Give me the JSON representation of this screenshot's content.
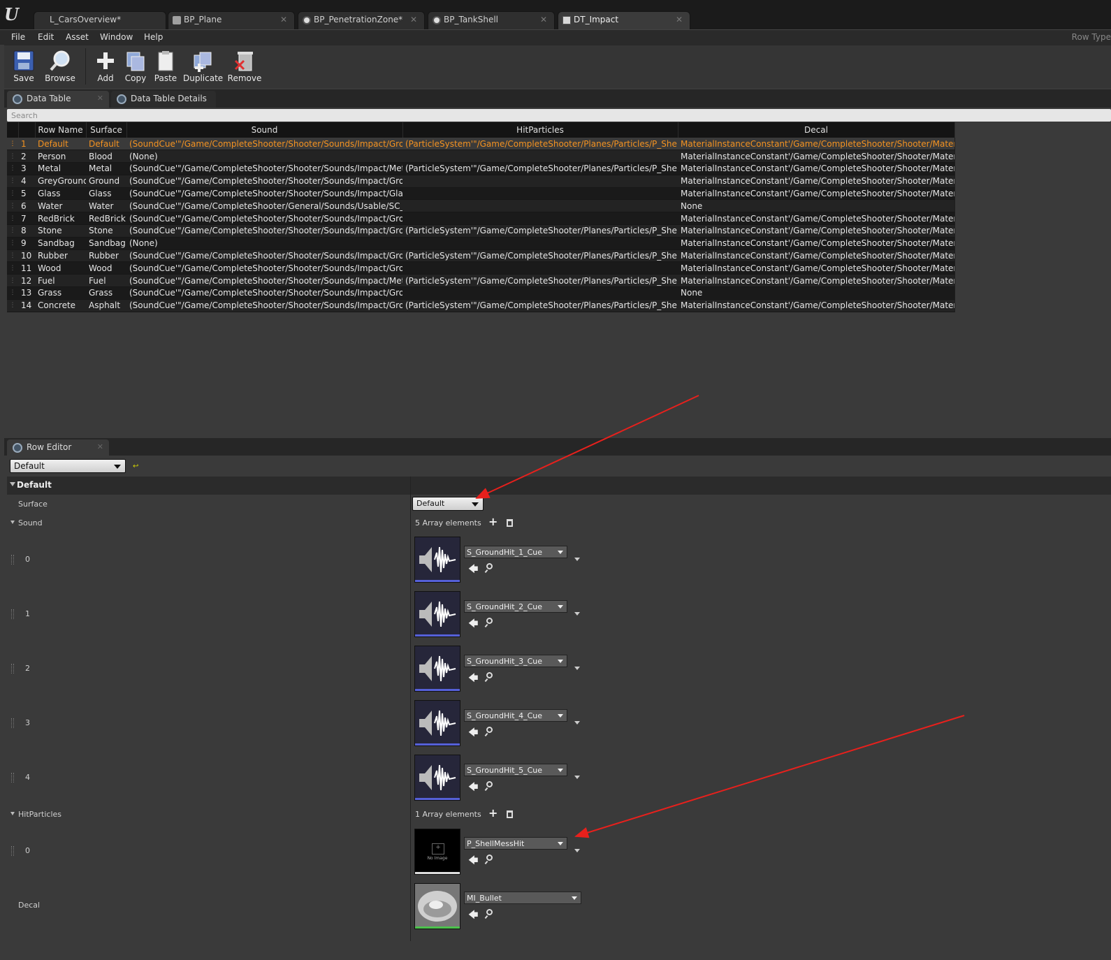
{
  "title_tabs": [
    {
      "label": "L_CarsOverview*",
      "icon": "level-icon"
    },
    {
      "label": "BP_Plane",
      "icon": "blueprint-icon"
    },
    {
      "label": "BP_PenetrationZone*",
      "icon": "blueprint-icon"
    },
    {
      "label": "BP_TankShell",
      "icon": "blueprint-icon"
    },
    {
      "label": "DT_Impact",
      "icon": "datatable-icon"
    }
  ],
  "menu": [
    "File",
    "Edit",
    "Asset",
    "Window",
    "Help"
  ],
  "menu_right": "Row Type",
  "toolbar": [
    "Save",
    "Browse",
    "Add",
    "Copy",
    "Paste",
    "Duplicate",
    "Remove"
  ],
  "panel_tabs": [
    "Data Table",
    "Data Table Details"
  ],
  "search_placeholder": "Search",
  "table": {
    "headers": [
      "Row Name",
      "Surface",
      "Sound",
      "HitParticles",
      "Decal"
    ],
    "rows": [
      [
        "1",
        "Default",
        "Default",
        "(SoundCue'\"/Game/CompleteShooter/Shooter/Sounds/Impact/GroundHi",
        "(ParticleSystem'\"/Game/CompleteShooter/Planes/Particles/P_ShellMess",
        "MaterialInstanceConstant'/Game/CompleteShooter/Shooter/Materials/E"
      ],
      [
        "2",
        "Person",
        "Blood",
        "(None)",
        "",
        "MaterialInstanceConstant'/Game/CompleteShooter/Shooter/Materials/E"
      ],
      [
        "3",
        "Metal",
        "Metal",
        "(SoundCue'\"/Game/CompleteShooter/Shooter/Sounds/Impact/MetalHit/",
        "(ParticleSystem'\"/Game/CompleteShooter/Planes/Particles/P_ShellMess",
        "MaterialInstanceConstant'/Game/CompleteShooter/Shooter/Materials/E"
      ],
      [
        "4",
        "GreyGround",
        "Ground",
        "(SoundCue'\"/Game/CompleteShooter/Shooter/Sounds/Impact/GroundHi",
        "",
        "MaterialInstanceConstant'/Game/CompleteShooter/Shooter/Materials/E"
      ],
      [
        "5",
        "Glass",
        "Glass",
        "(SoundCue'\"/Game/CompleteShooter/Shooter/Sounds/Impact/Glass/S_(",
        "",
        "MaterialInstanceConstant'/Game/CompleteShooter/Shooter/Materials/E"
      ],
      [
        "6",
        "Water",
        "Water",
        "(SoundCue'\"/Game/CompleteShooter/General/Sounds/Usable/SC_Water",
        "",
        "None"
      ],
      [
        "7",
        "RedBrick",
        "RedBrick",
        "(SoundCue'\"/Game/CompleteShooter/Shooter/Sounds/Impact/GroundHi",
        "",
        "MaterialInstanceConstant'/Game/CompleteShooter/Shooter/Materials/E"
      ],
      [
        "8",
        "Stone",
        "Stone",
        "(SoundCue'\"/Game/CompleteShooter/Shooter/Sounds/Impact/GroundHi",
        "(ParticleSystem'\"/Game/CompleteShooter/Planes/Particles/P_ShellMess",
        "MaterialInstanceConstant'/Game/CompleteShooter/Shooter/Materials/E"
      ],
      [
        "9",
        "Sandbag",
        "Sandbag",
        "(None)",
        "",
        "MaterialInstanceConstant'/Game/CompleteShooter/Shooter/Materials/E"
      ],
      [
        "10",
        "Rubber",
        "Rubber",
        "(SoundCue'\"/Game/CompleteShooter/Shooter/Sounds/Impact/GroundHi",
        "(ParticleSystem'\"/Game/CompleteShooter/Planes/Particles/P_ShellMess",
        "MaterialInstanceConstant'/Game/CompleteShooter/Shooter/Materials/E"
      ],
      [
        "11",
        "Wood",
        "Wood",
        "(SoundCue'\"/Game/CompleteShooter/Shooter/Sounds/Impact/GroundHi",
        "",
        "MaterialInstanceConstant'/Game/CompleteShooter/Shooter/Materials/E"
      ],
      [
        "12",
        "Fuel",
        "Fuel",
        "(SoundCue'\"/Game/CompleteShooter/Shooter/Sounds/Impact/MetalHit/",
        "(ParticleSystem'\"/Game/CompleteShooter/Planes/Particles/P_ShellMess",
        "MaterialInstanceConstant'/Game/CompleteShooter/Shooter/Materials/E"
      ],
      [
        "13",
        "Grass",
        "Grass",
        "(SoundCue'\"/Game/CompleteShooter/Shooter/Sounds/Impact/GroundHi",
        "",
        "None"
      ],
      [
        "14",
        "Concrete",
        "Asphalt",
        "(SoundCue'\"/Game/CompleteShooter/Shooter/Sounds/Impact/GroundHi",
        "(ParticleSystem'\"/Game/CompleteShooter/Planes/Particles/P_ShellMess",
        "MaterialInstanceConstant'/Game/CompleteShooter/Shooter/Materials/E"
      ]
    ]
  },
  "row_editor": {
    "tab": "Row Editor",
    "selected_row": "Default",
    "category": "Default",
    "surface_label": "Surface",
    "surface_value": "Default",
    "sound_label": "Sound",
    "sound_count": "5 Array elements",
    "sound_items": [
      {
        "index": "0",
        "asset": "S_GroundHit_1_Cue"
      },
      {
        "index": "1",
        "asset": "S_GroundHit_2_Cue"
      },
      {
        "index": "2",
        "asset": "S_GroundHit_3_Cue"
      },
      {
        "index": "3",
        "asset": "S_GroundHit_4_Cue"
      },
      {
        "index": "4",
        "asset": "S_GroundHit_5_Cue"
      }
    ],
    "particles_label": "HitParticles",
    "particles_count": "1 Array elements",
    "particle_items": [
      {
        "index": "0",
        "asset": "P_ShellMessHit",
        "thumb_text": "No Image"
      }
    ],
    "decal_label": "Decal",
    "decal_asset": "MI_Bullet"
  },
  "colors": {
    "selected_row": "#f39221",
    "annotation_arrow": "#e8201c"
  }
}
